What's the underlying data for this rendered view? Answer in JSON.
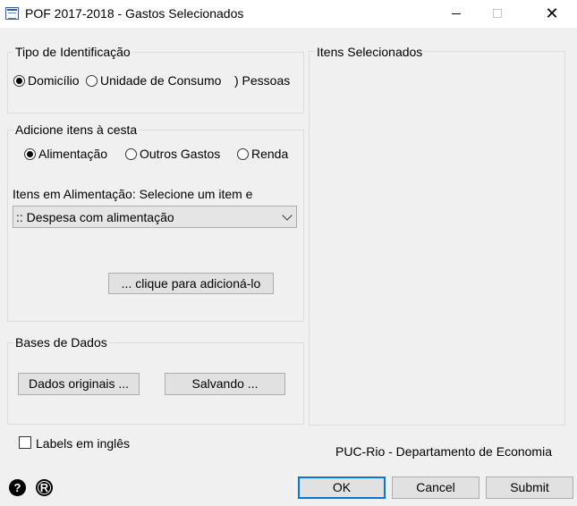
{
  "window": {
    "title": "POF 2017-2018 - Gastos Selecionados",
    "close_glyph": "✕"
  },
  "tipo": {
    "legend": "Tipo de Identificação",
    "options": [
      "Domicílio",
      "Unidade de Consumo",
      "Pessoas"
    ],
    "visible_text": [
      "Domicílio",
      "Unidade de Consumo",
      ") Pessoas"
    ],
    "selected": "Domicílio"
  },
  "cesta": {
    "legend": "Adicione itens à cesta",
    "options": [
      "Alimentação",
      "Outros Gastos",
      "Renda"
    ],
    "selected": "Alimentação",
    "items_label": "Itens em Alimentação: Selecione um item e",
    "dropdown_value": ":: Despesa com alimentação",
    "add_button": "... clique para adicioná-lo"
  },
  "bases": {
    "legend": "Bases de Dados",
    "dados_button": "Dados originais ...",
    "salvando_button": "Salvando ..."
  },
  "selected_items": {
    "label": "Itens Selecionados",
    "items": []
  },
  "labels_checkbox": {
    "label": "Labels em inglês",
    "checked": false
  },
  "footer_text": "PUC-Rio - Departamento de Economia",
  "buttons": {
    "ok": "OK",
    "cancel": "Cancel",
    "submit": "Submit"
  },
  "icons": {
    "help": "?",
    "r": "R"
  }
}
